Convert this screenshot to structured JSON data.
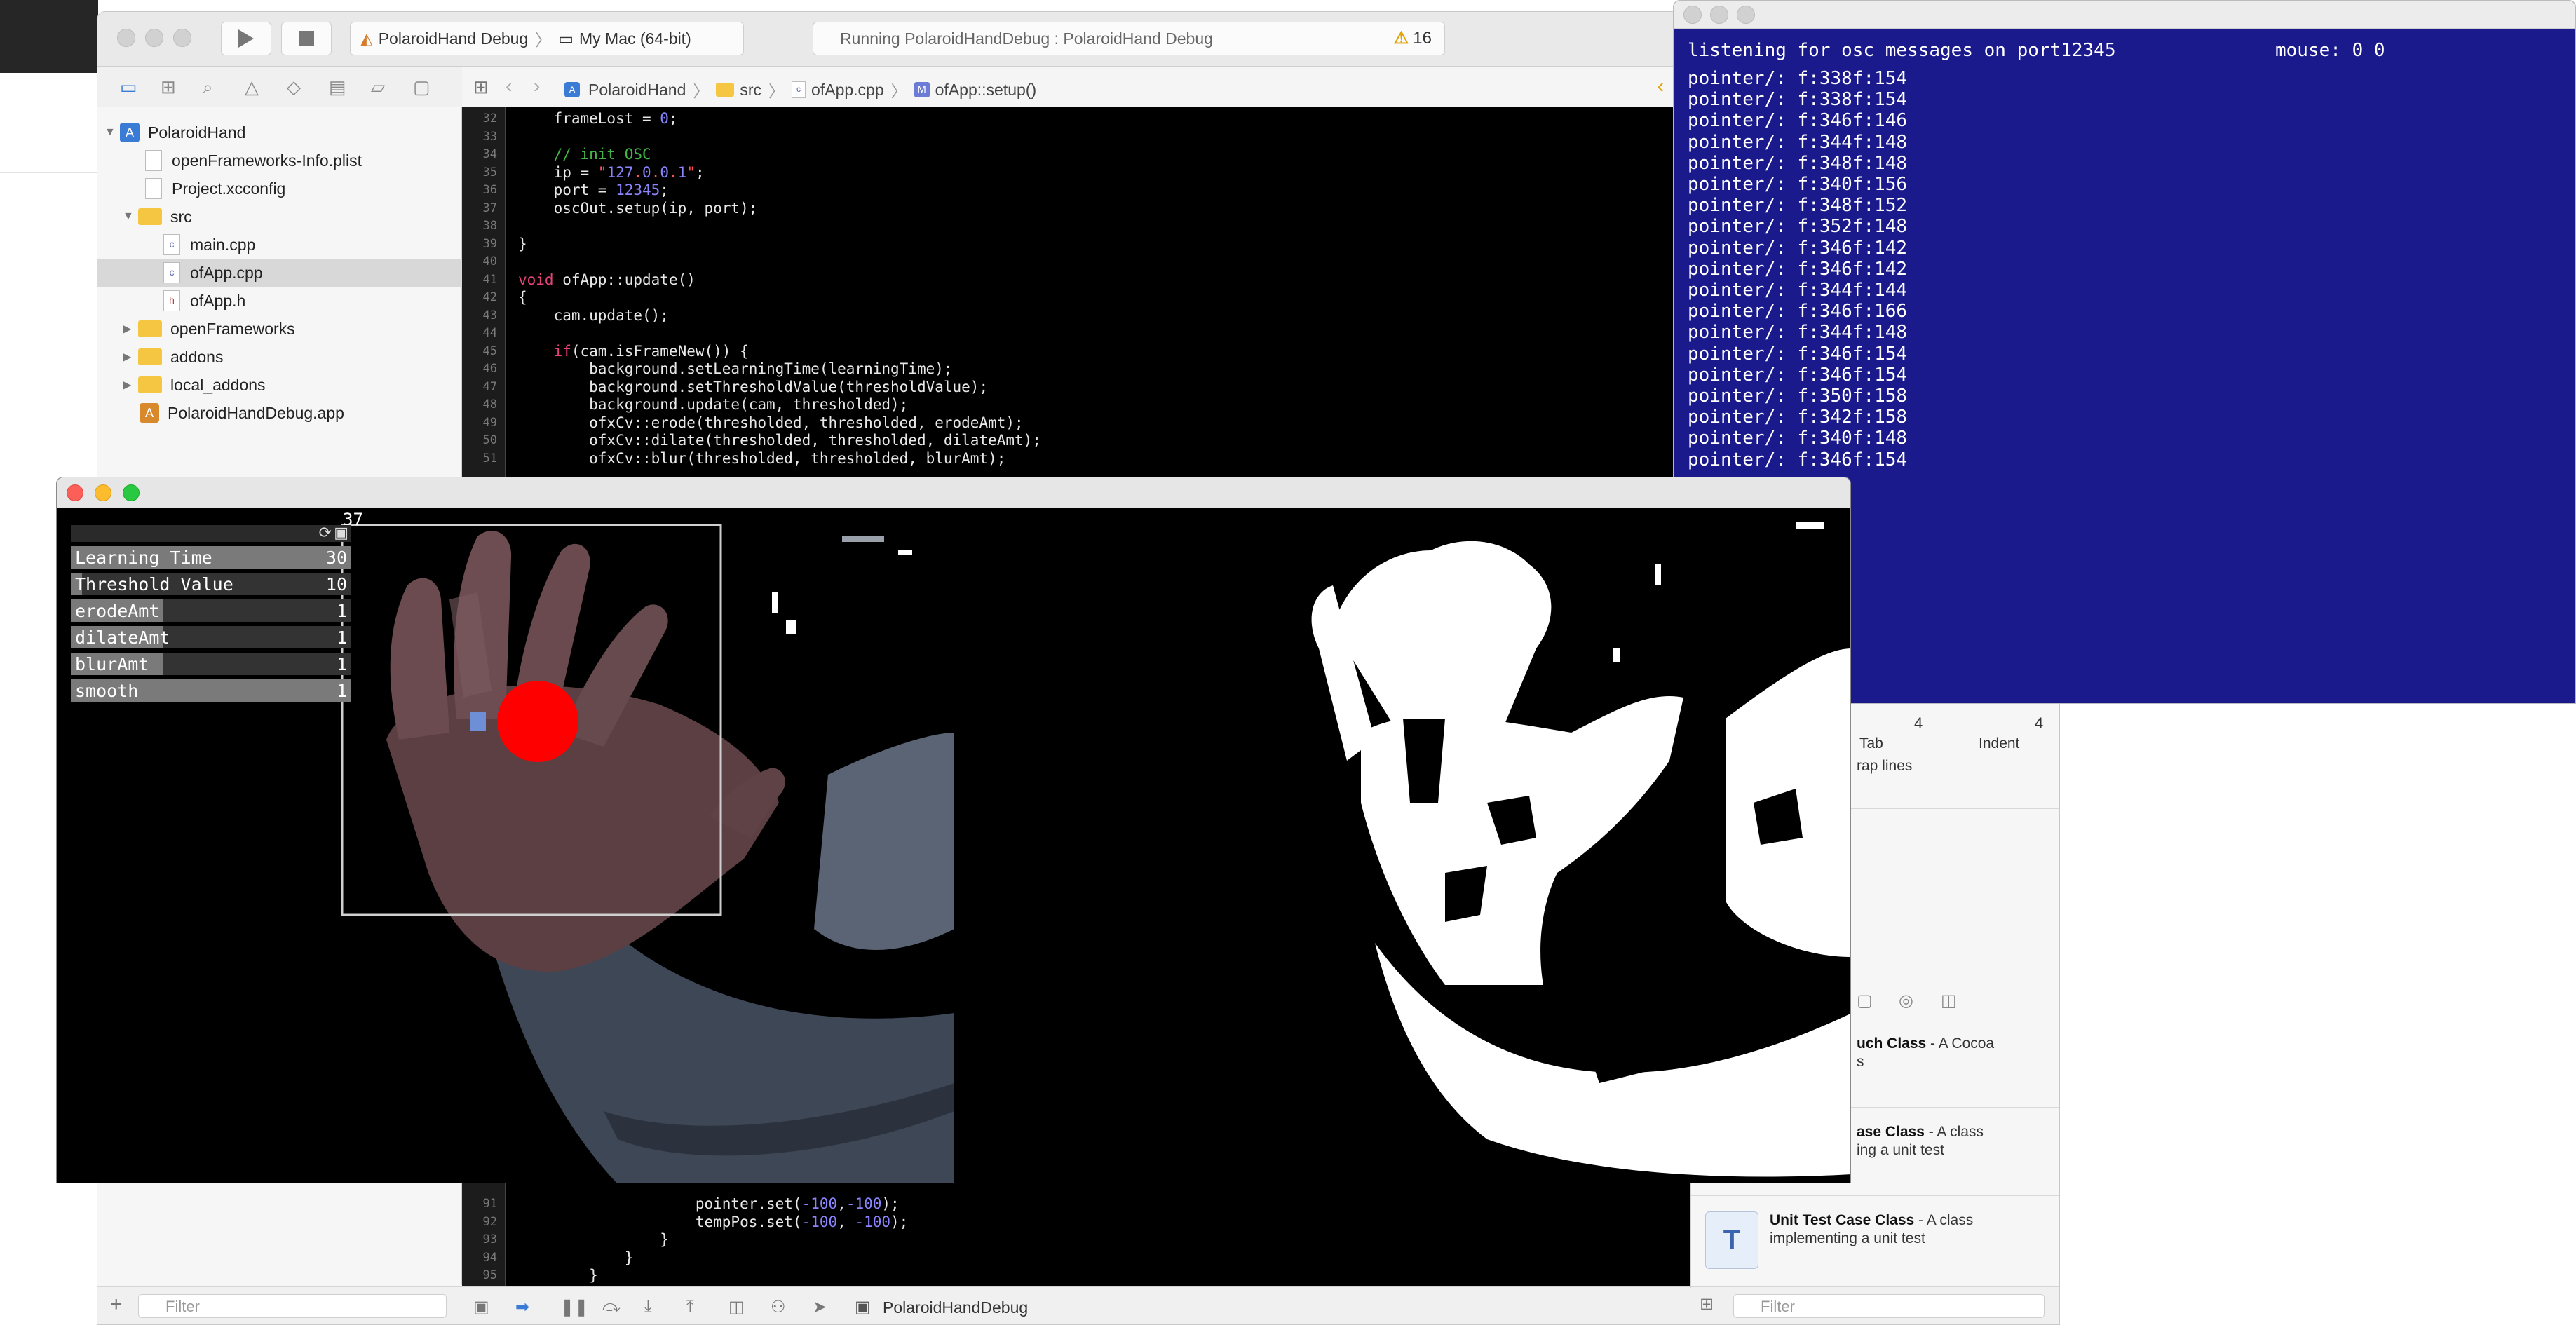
{
  "xcode": {
    "scheme": "PolaroidHand Debug",
    "destination": "My Mac (64-bit)",
    "status_text": "Running PolaroidHandDebug : PolaroidHand Debug",
    "warning_count": "16",
    "navigator": {
      "items": [
        {
          "label": "PolaroidHand",
          "kind": "project"
        },
        {
          "label": "openFrameworks-Info.plist",
          "kind": "file"
        },
        {
          "label": "Project.xcconfig",
          "kind": "file"
        },
        {
          "label": "src",
          "kind": "folder"
        },
        {
          "label": "main.cpp",
          "kind": "file"
        },
        {
          "label": "ofApp.cpp",
          "kind": "file",
          "selected": true
        },
        {
          "label": "ofApp.h",
          "kind": "file"
        },
        {
          "label": "openFrameworks",
          "kind": "folder"
        },
        {
          "label": "addons",
          "kind": "folder"
        },
        {
          "label": "local_addons",
          "kind": "folder"
        },
        {
          "label": "PolaroidHandDebug.app",
          "kind": "app"
        }
      ],
      "filter_placeholder": "Filter"
    },
    "jumpbar": {
      "project": "PolaroidHand",
      "group": "src",
      "file": "ofApp.cpp",
      "method": "ofApp::setup()"
    },
    "code_top_lines": [
      {
        "n": "32",
        "text": "    frameLost = 0;"
      },
      {
        "n": "33",
        "text": ""
      },
      {
        "n": "34",
        "text": "    // init OSC"
      },
      {
        "n": "35",
        "text": "    ip = \"127.0.0.1\";"
      },
      {
        "n": "36",
        "text": "    port = 12345;"
      },
      {
        "n": "37",
        "text": "    oscOut.setup(ip, port);"
      },
      {
        "n": "38",
        "text": ""
      },
      {
        "n": "39",
        "text": "}"
      },
      {
        "n": "40",
        "text": ""
      },
      {
        "n": "41",
        "text": "void ofApp::update()"
      },
      {
        "n": "42",
        "text": "{"
      },
      {
        "n": "43",
        "text": "    cam.update();"
      },
      {
        "n": "44",
        "text": ""
      },
      {
        "n": "45",
        "text": "    if(cam.isFrameNew()) {"
      },
      {
        "n": "46",
        "text": "        background.setLearningTime(learningTime);"
      },
      {
        "n": "47",
        "text": "        background.setThresholdValue(thresholdValue);"
      },
      {
        "n": "48",
        "text": "        background.update(cam, thresholded);"
      },
      {
        "n": "49",
        "text": "        ofxCv::erode(thresholded, thresholded, erodeAmt);"
      },
      {
        "n": "50",
        "text": "        ofxCv::dilate(thresholded, thresholded, dilateAmt);"
      },
      {
        "n": "51",
        "text": "        ofxCv::blur(thresholded, thresholded, blurAmt);"
      }
    ],
    "code_bottom_lines": [
      {
        "n": "91",
        "text": "                    pointer.set(-100,-100);"
      },
      {
        "n": "92",
        "text": "                    tempPos.set(-100, -100);"
      },
      {
        "n": "93",
        "text": "                }"
      },
      {
        "n": "94",
        "text": "            }"
      },
      {
        "n": "95",
        "text": "        }"
      }
    ],
    "debug_target": "PolaroidHandDebug",
    "inspector": {
      "tab_label": "Tab",
      "tab_value": "4",
      "indent_label": "Indent",
      "indent_value": "4",
      "wrap_lines": "rap lines",
      "library": [
        {
          "title": "uch Class",
          "desc": " - A Cocoa",
          "desc2": "s",
          "icon": ""
        },
        {
          "title": "ase Class",
          "desc": " - A class",
          "desc2": "ing a unit test",
          "icon": ""
        },
        {
          "title": "Unit Test Case Class",
          "desc": " - A class",
          "desc2": "implementing a unit test",
          "icon": "T"
        }
      ],
      "filter_placeholder": "Filter"
    }
  },
  "osc_window": {
    "header": "listening for osc messages on port12345",
    "mouse": "mouse: 0 0",
    "messages": [
      "pointer/: f:338f:154",
      "pointer/: f:338f:154",
      "pointer/: f:346f:146",
      "pointer/: f:344f:148",
      "pointer/: f:348f:148",
      "pointer/: f:340f:156",
      "pointer/: f:348f:152",
      "pointer/: f:352f:148",
      "pointer/: f:346f:142",
      "pointer/: f:346f:142",
      "pointer/: f:344f:144",
      "pointer/: f:346f:166",
      "pointer/: f:344f:148",
      "pointer/: f:346f:154",
      "pointer/: f:346f:154",
      "pointer/: f:350f:158",
      "pointer/: f:342f:158",
      "pointer/: f:340f:148",
      "pointer/: f:346f:154"
    ]
  },
  "camera_window": {
    "fps": "37",
    "gui": [
      {
        "label": "Learning Time",
        "value": "30",
        "fill": 1.0
      },
      {
        "label": "Threshold Value",
        "value": "10",
        "fill": 0.04
      },
      {
        "label": "erodeAmt",
        "value": "1",
        "fill": 0.33
      },
      {
        "label": "dilateAmt",
        "value": "1",
        "fill": 0.33
      },
      {
        "label": "blurAmt",
        "value": "1",
        "fill": 0.33
      },
      {
        "label": "smooth",
        "value": "1",
        "fill": 1.0
      }
    ]
  },
  "colors": {
    "osc_bg": "#1a1a8c",
    "tracker_dot": "#ff0000",
    "keyword": "#e6427a",
    "string": "#ff5252",
    "number": "#8b84ff",
    "comment": "#41b645"
  }
}
